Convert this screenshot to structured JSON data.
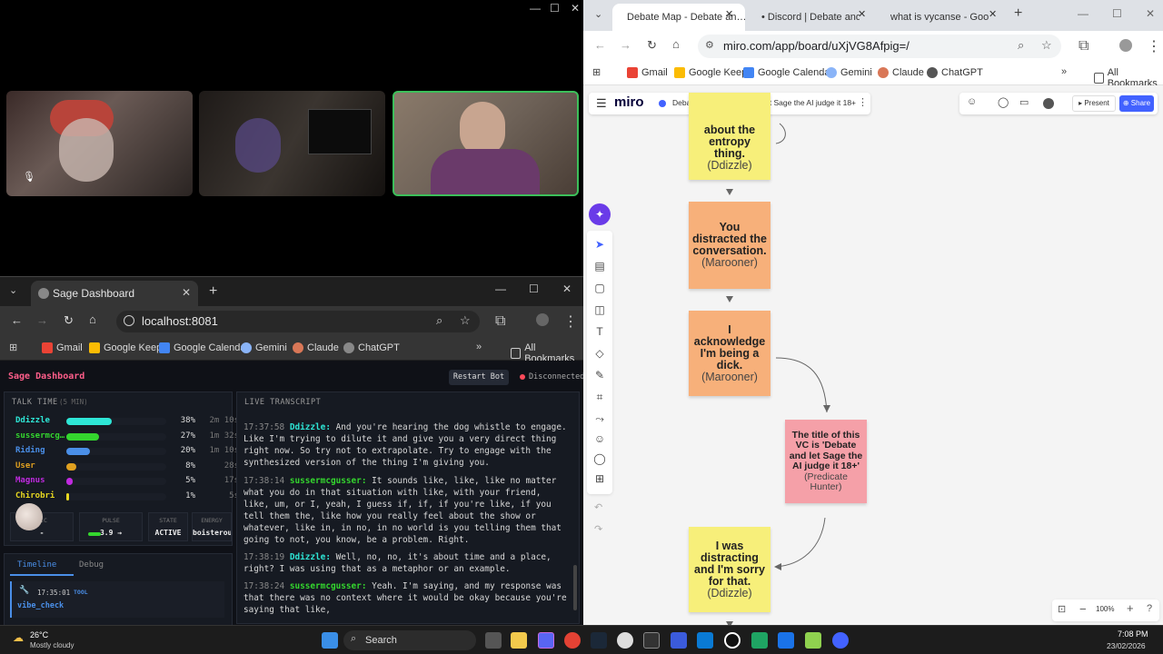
{
  "video_window": {
    "controls": [
      "—",
      "☐",
      "✕"
    ]
  },
  "sage_browser": {
    "tab_title": "Sage Dashboard",
    "url": "localhost:8081",
    "bookmarks": [
      "Gmail",
      "Google Keep",
      "Google Calendar",
      "Gemini",
      "Claude",
      "ChatGPT"
    ],
    "all_bookmarks": "All Bookmarks"
  },
  "dashboard": {
    "title": "Sage Dashboard",
    "restart_label": "Restart Bot",
    "status": "Disconnected",
    "talk_time_header": "TALK TIME",
    "talk_time_sub": "(5 MIN)",
    "speakers": [
      {
        "name": "Ddizzle",
        "pct": "38%",
        "time": "2m 10s",
        "frac": 0.38,
        "color": "#2ee6d6",
        "bar": "#2ee6d6"
      },
      {
        "name": "sussermcg…",
        "pct": "27%",
        "time": "1m 32s",
        "frac": 0.27,
        "color": "#34d62e",
        "bar": "#34d62e"
      },
      {
        "name": "Riding",
        "pct": "20%",
        "time": "1m 10s",
        "frac": 0.2,
        "color": "#4a8fe8",
        "bar": "#4a8fe8"
      },
      {
        "name": "User",
        "pct": "8%",
        "time": "28s",
        "frac": 0.08,
        "color": "#e0a020",
        "bar": "#e0a020"
      },
      {
        "name": "Magnus",
        "pct": "5%",
        "time": "17s",
        "frac": 0.05,
        "color": "#c02ae0",
        "bar": "#c02ae0"
      },
      {
        "name": "Chirobri",
        "pct": "1%",
        "time": "5s",
        "frac": 0.01,
        "color": "#e8d820",
        "bar": "#e8d820"
      }
    ],
    "stats": [
      {
        "label": "PIC",
        "value": "-"
      },
      {
        "label": "PULSE",
        "value": "3.9 →"
      },
      {
        "label": "STATE",
        "value": "ACTIVE"
      },
      {
        "label": "ENERGY",
        "value": "boisterous"
      }
    ],
    "tabs": [
      "Timeline",
      "Debug"
    ],
    "timeline_item": {
      "time": "17:35:01",
      "tag": "TOOL",
      "name": "vibe_check"
    },
    "transcript_header": "LIVE TRANSCRIPT",
    "transcript": [
      {
        "ts": "17:37:58",
        "speaker": "Ddizzle:",
        "color": "#2ee6d6",
        "text": "And you're hearing the dog whistle to engage. Like I'm trying to dilute it and give you a very direct thing right now. So try not to extrapolate. Try to engage with the synthesized version of the thing I'm giving you."
      },
      {
        "ts": "17:38:14",
        "speaker": "sussermcgusser:",
        "color": "#34d62e",
        "text": "It sounds like, like, like no matter what you do in that situation with like, with your friend, like, um, or I, yeah, I guess if, if, if you're like, if you tell them the, like how you really feel about the show or whatever, like in, in no, in no world is you telling them that going to not, you know, be a problem. Right."
      },
      {
        "ts": "17:38:19",
        "speaker": "Ddizzle:",
        "color": "#2ee6d6",
        "text": "Well, no, no, it's about time and a place, right? I was using that as a metaphor or an example."
      },
      {
        "ts": "17:38:24",
        "speaker": "sussermcgusser:",
        "color": "#34d62e",
        "text": "Yeah. I'm saying, and my response was that there was no context where it would be okay because you're saying that like,"
      }
    ]
  },
  "taskbar": {
    "weather_temp": "26°C",
    "weather_desc": "Mostly cloudy",
    "search": "Search",
    "time": "7:08 PM",
    "date": "23/02/2026"
  },
  "right_browser": {
    "tabs": [
      "Debate Map - Debate an…",
      "• Discord | Debate and …",
      "what is vycanse - Googl…"
    ],
    "url": "miro.com/app/board/uXjVG8Afpig=/",
    "bookmarks": [
      "Gmail",
      "Google Keep",
      "Google Calendar",
      "Gemini",
      "Claude",
      "ChatGPT"
    ],
    "all_bookmarks": "All Bookmarks"
  },
  "miro": {
    "logo": "miro",
    "board_title": "Debate Map - Debate and let Sage the AI judge it 18+",
    "present": "Present",
    "share": "Share",
    "zoom": "100%",
    "notes": [
      {
        "text": "about the entropy thing.",
        "who": "(Ddizzle)",
        "color": "#f7ef7a"
      },
      {
        "text": "You distracted the conversation.",
        "who": "(Marooner)",
        "color": "#f7b07a"
      },
      {
        "text": "I acknowledge I'm being a dick.",
        "who": "(Marooner)",
        "color": "#f7b07a"
      },
      {
        "text": "The title of this VC is 'Debate and let Sage the AI judge it 18+'",
        "who": "(Predicate Hunter)",
        "color": "#f5a0a8"
      },
      {
        "text": "I was distracting and I'm sorry for that.",
        "who": "(Ddizzle)",
        "color": "#f7ef7a"
      }
    ]
  },
  "colors": {
    "accent": "#ff5e8a",
    "miro_blue": "#4262ff"
  }
}
